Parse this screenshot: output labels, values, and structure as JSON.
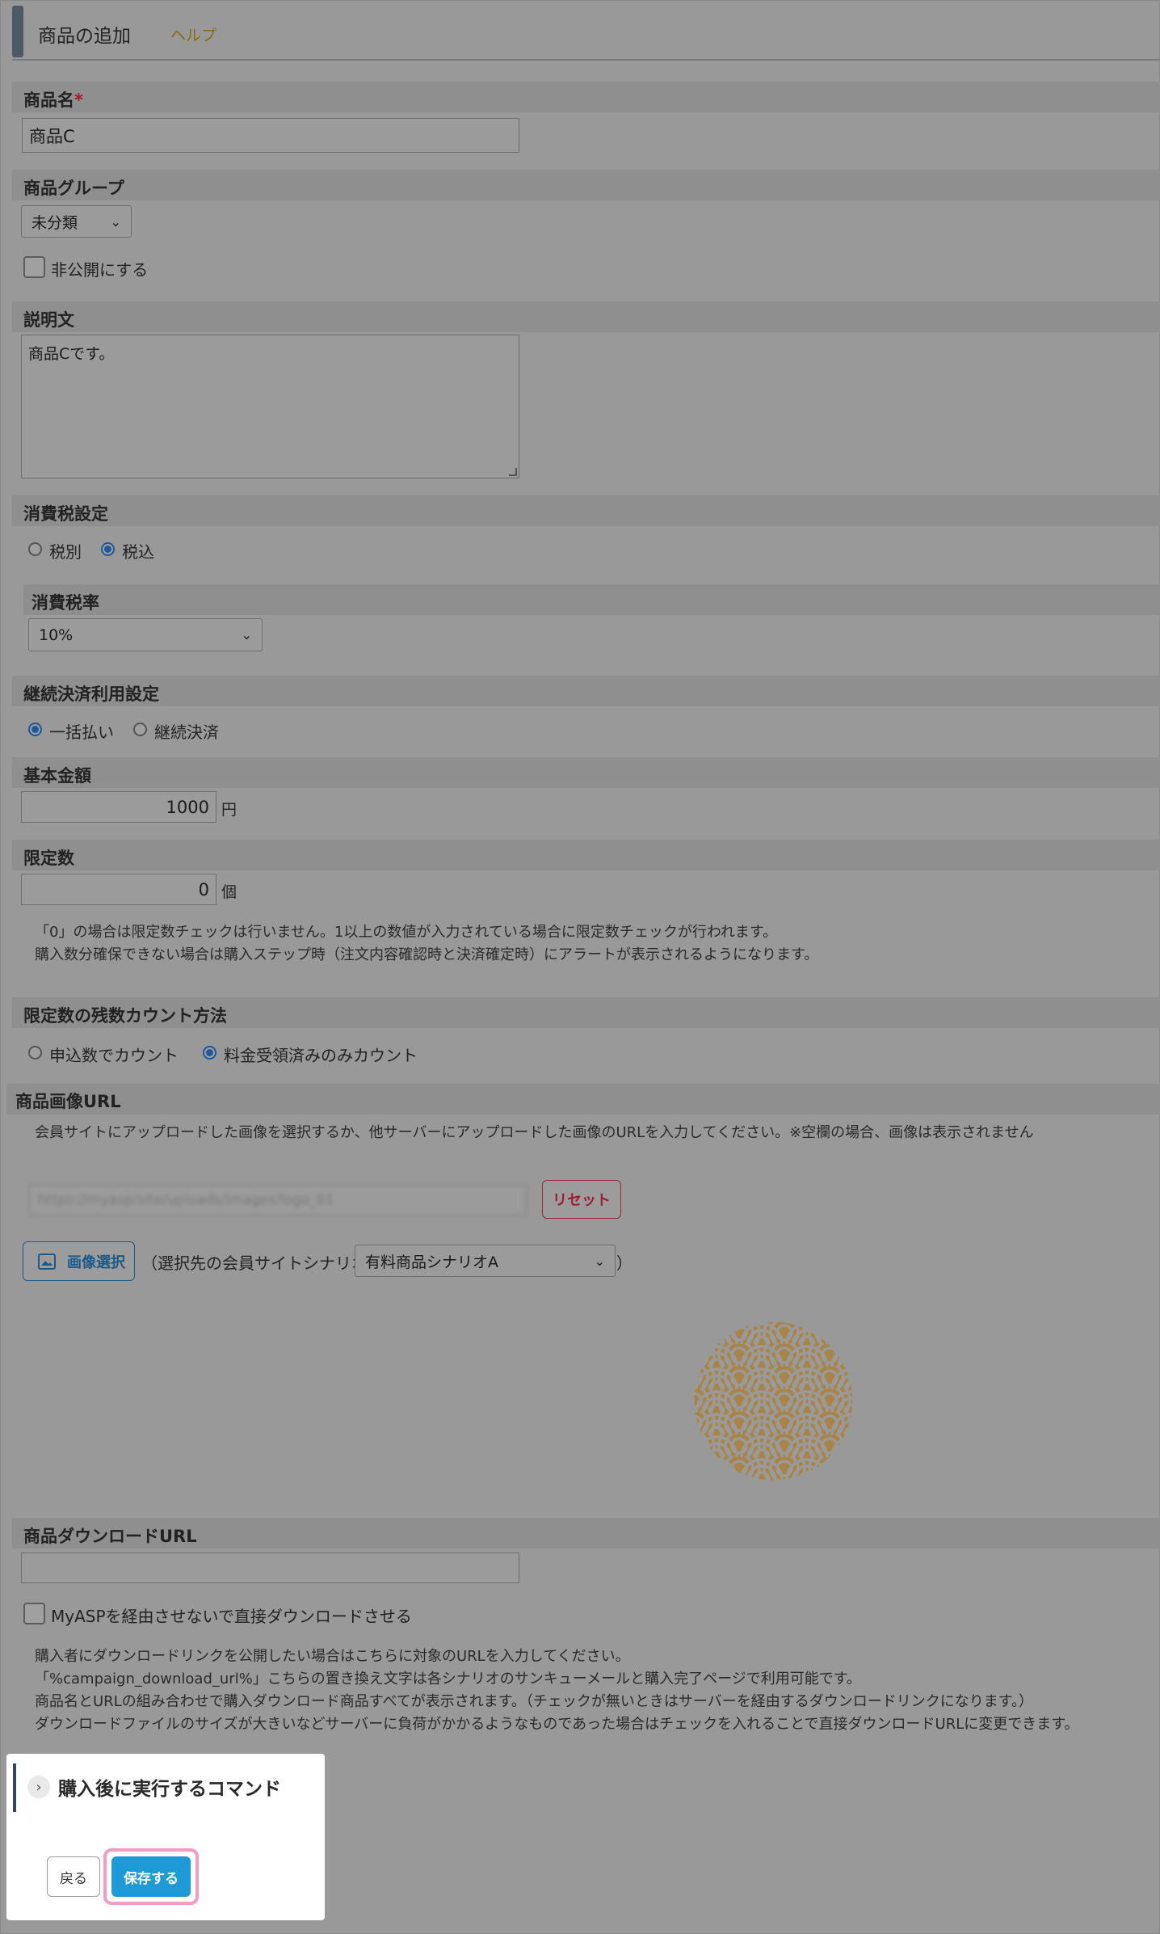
{
  "header": {
    "title": "商品の追加",
    "help": "ヘルプ"
  },
  "product_name": {
    "label": "商品名",
    "required_mark": "*",
    "value": "商品C"
  },
  "product_group": {
    "label": "商品グループ",
    "selected": "未分類"
  },
  "private": {
    "label": "非公開にする",
    "checked": false
  },
  "description": {
    "label": "説明文",
    "value": "商品Cです。"
  },
  "tax": {
    "label": "消費税設定",
    "options": [
      "税別",
      "税込"
    ],
    "selected": "税込"
  },
  "tax_rate": {
    "label": "消費税率",
    "selected": "10%"
  },
  "recurring": {
    "label": "継続決済利用設定",
    "options": [
      "一括払い",
      "継続決済"
    ],
    "selected": "一括払い"
  },
  "base_price": {
    "label": "基本金額",
    "value": "1000",
    "unit": "円"
  },
  "limit": {
    "label": "限定数",
    "value": "0",
    "unit": "個",
    "notes": [
      "「0」の場合は限定数チェックは行いません。1以上の数値が入力されている場合に限定数チェックが行われます。",
      "購入数分確保できない場合は購入ステップ時（注文内容確認時と決済確定時）にアラートが表示されるようになります。"
    ]
  },
  "count_method": {
    "label": "限定数の残数カウント方法",
    "options": [
      "申込数でカウント",
      "料金受領済みのみカウント"
    ],
    "selected": "料金受領済みのみカウント"
  },
  "image_url": {
    "label": "商品画像URL",
    "note": "会員サイトにアップロードした画像を選択するか、他サーバーにアップロードした画像のURLを入力してください。※空欄の場合、画像は表示されません",
    "value": "https://myasp/site/uploads/images/logo_01",
    "reset_label": "リセット",
    "select_label": "画像選択",
    "scenario_prefix": "（選択先の会員サイトシナリオ",
    "scenario_selected": "有料商品シナリオA",
    "scenario_suffix": "）"
  },
  "download_url": {
    "label": "商品ダウンロードURL",
    "value": "",
    "direct_label": "MyASPを経由させないで直接ダウンロードさせる",
    "notes": [
      "購入者にダウンロードリンクを公開したい場合はこちらに対象のURLを入力してください。",
      "「%campaign_download_url%」こちらの置き換え文字は各シナリオのサンキューメールと購入完了ページで利用可能です。",
      "商品名とURLの組み合わせで購入ダウンロード商品すべてが表示されます。（チェックが無いときはサーバーを経由するダウンロードリンクになります。）",
      "ダウンロードファイルのサイズが大きいなどサーバーに負荷がかかるようなものであった場合はチェックを入れることで直接ダウンロードURLに変更できます。"
    ]
  },
  "command": {
    "title": "購入後に実行するコマンド"
  },
  "actions": {
    "back": "戻る",
    "save": "保存する"
  },
  "colors": {
    "accent_blue": "#1e9ad6",
    "reset_red": "#9e1d32",
    "help_gold": "#8a6a12",
    "highlight_pink": "#f49bc4",
    "seigaiha_gold": "#a88448"
  },
  "icons": {
    "image_select": "image-icon",
    "expand": "chevron-right-icon",
    "dropdown": "chevron-down-icon"
  }
}
